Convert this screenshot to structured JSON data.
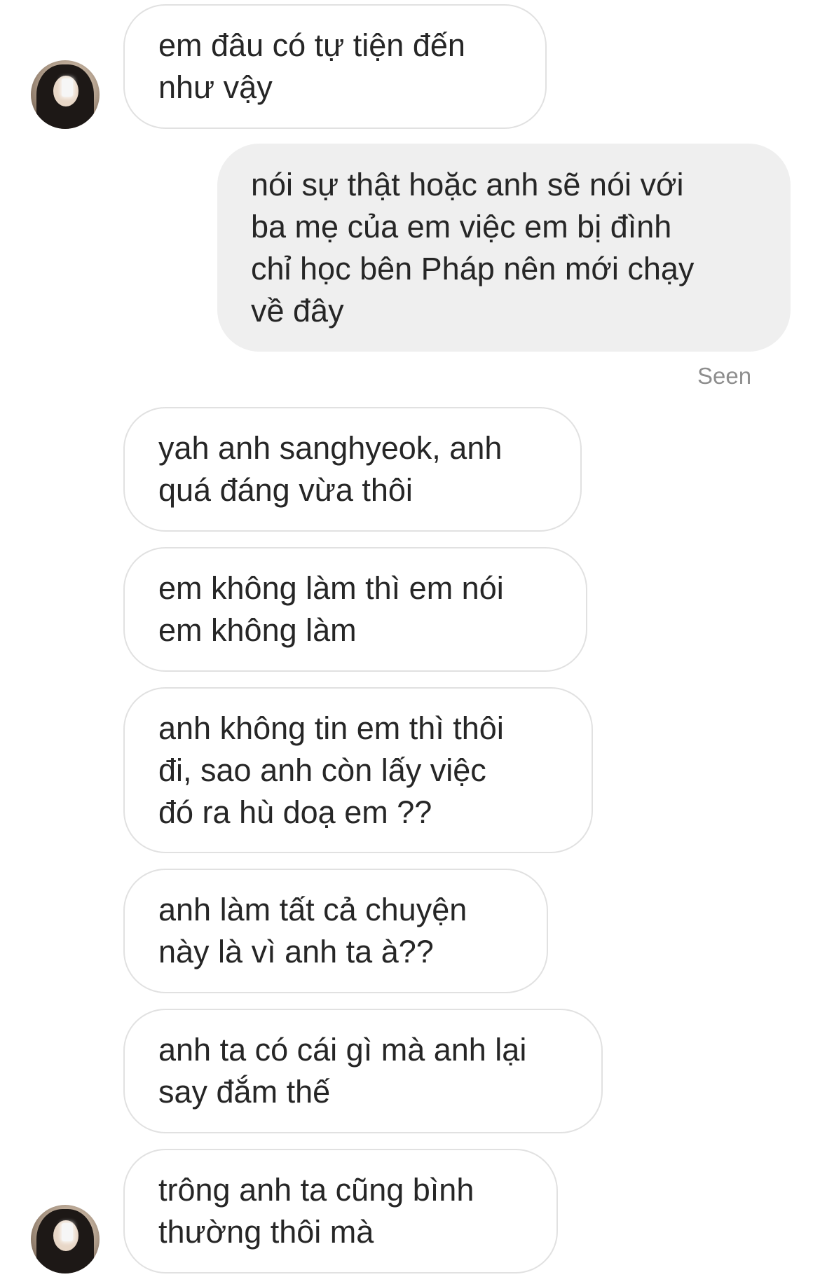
{
  "conversation": {
    "messages": [
      {
        "direction": "incoming",
        "text": "em đâu có tự tiện đến\nnhư vậy"
      },
      {
        "direction": "outgoing",
        "text": "nói sự thật hoặc anh sẽ nói với\nba mẹ của em việc em bị đình\nchỉ học bên Pháp nên mới chạy\nvề đây"
      },
      {
        "direction": "incoming",
        "text": "yah anh sanghyeok, anh\nquá đáng vừa thôi"
      },
      {
        "direction": "incoming",
        "text": "em không làm thì em nói\nem không làm"
      },
      {
        "direction": "incoming",
        "text": "anh không tin em thì thôi\nđi, sao anh còn lấy việc\nđó ra hù doạ em ??"
      },
      {
        "direction": "incoming",
        "text": "anh làm tất cả chuyện\nnày là vì anh ta à??"
      },
      {
        "direction": "incoming",
        "text": "anh ta có cái gì mà anh lại\nsay đắm thế"
      },
      {
        "direction": "incoming",
        "text": "trông anh ta cũng bình\nthường thôi mà"
      }
    ],
    "seen_label": "Seen"
  },
  "colors": {
    "incoming_bubble_bg": "#ffffff",
    "incoming_bubble_border": "#e1e1e1",
    "outgoing_bubble_bg": "#efefef",
    "text": "#262626",
    "seen_text": "#8e8e8e"
  }
}
